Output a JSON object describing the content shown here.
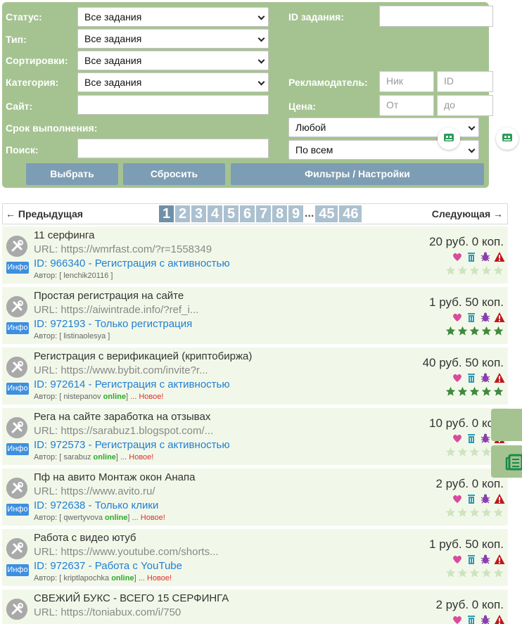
{
  "filters": {
    "status_label": "Статус:",
    "status_value": "Все задания",
    "type_label": "Тип:",
    "type_value": "Все задания",
    "sort_label": "Сортировки:",
    "sort_value": "Все задания",
    "category_label": "Категория:",
    "category_value": "Все задания",
    "site_label": "Сайт:",
    "site_value": "",
    "deadline_label": "Срок выполнения:",
    "deadline_value": "Любой",
    "search_label": "Поиск:",
    "search_value": "",
    "search_scope_value": "По всем",
    "task_id_label": "ID задания:",
    "task_id_value": "",
    "advertiser_label": "Рекламодатель:",
    "advertiser_nick_placeholder": "Ник",
    "advertiser_id_placeholder": "ID",
    "price_label": "Цена:",
    "price_from_placeholder": "От",
    "price_to_placeholder": "до",
    "select_button": "Выбрать",
    "reset_button": "Сбросить",
    "settings_button": "Фильтры / Настройки"
  },
  "pager": {
    "prev": "← Предыдущая",
    "next": "Следующая →",
    "pages": [
      "1",
      "2",
      "3",
      "4",
      "5",
      "6",
      "7",
      "8",
      "9"
    ],
    "dots": "...",
    "last_pages": [
      "45",
      "46"
    ],
    "active_page": "1"
  },
  "info_label": "Инфо",
  "author_prefix": "Автор: [",
  "author_suffix": "]",
  "online_label": "online",
  "new_label": "... Новое!",
  "tasks": [
    {
      "title": "11 серфинга",
      "url": "URL: https://wmrfast.com/?r=1558349",
      "id_line": "ID: 966340 - Регистрация с активностью",
      "author": "lenchik20116",
      "online": false,
      "is_new": false,
      "price": "20 руб. 0 коп.",
      "rating": 0
    },
    {
      "title": "Простая регистрация на сайте",
      "url": "URL: https://aiwintrade.info/?ref_i...",
      "id_line": "ID: 972193 - Только регистрация",
      "author": "listinaolesya",
      "online": false,
      "is_new": false,
      "price": "1 руб. 50 коп.",
      "rating": 5
    },
    {
      "title": "Регистрация с верификацией (криптобиржа)",
      "url": "URL: https://www.bybit.com/invite?r...",
      "id_line": "ID: 972614 - Регистрация с активностью",
      "author": "nistepanov",
      "online": true,
      "is_new": true,
      "price": "40 руб. 50 коп.",
      "rating": 5
    },
    {
      "title": "Рега на сайте заработка на отзывах",
      "url": "URL: https://sarabuz1.blogspot.com/...",
      "id_line": "ID: 972573 - Регистрация с активностью",
      "author": "sarabuz",
      "online": true,
      "is_new": true,
      "price": "10 руб. 0 коп.",
      "rating": 0
    },
    {
      "title": "Пф на авито Монтаж окон Анапа",
      "url": "URL: https://www.avito.ru/",
      "id_line": "ID: 972638 - Только клики",
      "author": "qwertyvova",
      "online": true,
      "is_new": true,
      "price": "2 руб. 0 коп.",
      "rating": 0
    },
    {
      "title": "Работа с видео ютуб",
      "url": "URL: https://www.youtube.com/shorts...",
      "id_line": "ID: 972637 - Работа с YouTube",
      "author": "kriptlapochka",
      "online": true,
      "is_new": true,
      "price": "1 руб. 50 коп.",
      "rating": 0
    },
    {
      "title": "СВЕЖИЙ БУКС - ВСЕГО 15 СЕРФИНГА",
      "url": "URL: https://toniabux.com/i/750",
      "id_line": "",
      "author": "",
      "online": false,
      "is_new": false,
      "price": "2 руб. 0 коп.",
      "rating": 0
    }
  ],
  "colors": {
    "panel": "#a5c391",
    "link": "#1e7fd6",
    "star_on": "#3f8a3f",
    "star_off": "#cfe3c1",
    "heart": "#d84c9e",
    "trash": "#2f9bb0",
    "bug": "#8a3fb0",
    "warn": "#c0161e"
  }
}
